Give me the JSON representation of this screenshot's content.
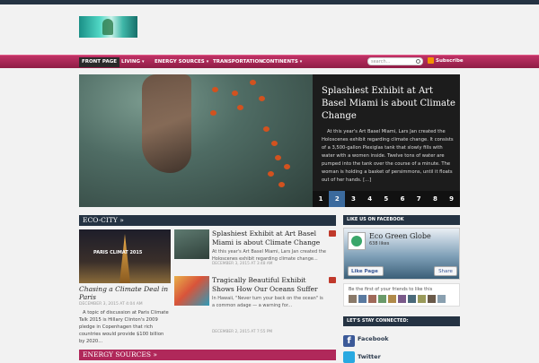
{
  "nav": {
    "items": [
      {
        "label": "FRONT PAGE",
        "active": true,
        "has_dropdown": false
      },
      {
        "label": "LIVING",
        "active": false,
        "has_dropdown": true
      },
      {
        "label": "ENERGY SOURCES",
        "active": false,
        "has_dropdown": true
      },
      {
        "label": "TRANSPORTATION",
        "active": false,
        "has_dropdown": false
      },
      {
        "label": "CONTINENTS",
        "active": false,
        "has_dropdown": true
      }
    ],
    "search_placeholder": "search...",
    "subscribe_label": "Subscribe"
  },
  "slider": {
    "title": "Splashiest Exhibit at Art Basel Miami is about Climate Change",
    "text": "At this year's Art Basel Miami, Lars Jan created the Holoscenes exhibit regarding climate change. It consists of a 3,500-gallon Plexiglas tank that slowly fills with water with a women inside. Twelve tons of water are pumped into the tank over the course of a minute. The woman is holding a basket of persimmons, until it floats out of her hands. [...]",
    "pages": [
      "1",
      "2",
      "3",
      "4",
      "5",
      "6",
      "7",
      "8",
      "9",
      "10"
    ],
    "active_page": "2"
  },
  "eco_city": {
    "heading": "ECO-CITY »",
    "feature": {
      "image_label": "PARIS CLIMAT 2015",
      "title": "Chasing a Climate Deal in Paris",
      "date": "DECEMBER 3, 2015 AT 4:04 AM",
      "excerpt": "A topic of discussion at Paris Climate Talk 2015 is Hillary Clinton's 2009 pledge in Copenhagen that rich countries would provide $100 billion by 2020..."
    },
    "posts": [
      {
        "title": "Splashiest Exhibit at Art Basel Miami is about Climate Change",
        "excerpt": "At this year's Art Basel Miami, Lars Jan created the Holoscenes exhibit regarding climate change...",
        "date": "DECEMBER 3, 2015 AT 3:48 AM",
        "comments": "0"
      },
      {
        "title": "Tragically Beautiful Exhibit Shows How Our Oceans Suffer",
        "excerpt": "In Hawaii, \"Never turn your back on the ocean\" is a common adage — a warning for...",
        "date": "DECEMBER 2, 2015 AT 7:55 PM",
        "comments": "0"
      }
    ]
  },
  "energy_sources": {
    "heading": "ENERGY SOURCES »"
  },
  "sidebar": {
    "facebook_heading": "LIKE US ON FACEBOOK",
    "page_name": "Eco Green Globe",
    "likes": "638 likes",
    "like_button": "Like Page",
    "share_button": "Share",
    "friends_text": "Be the first of your friends to like this",
    "connect_heading": "LET'S STAY CONNECTED:",
    "connect_items": [
      "Facebook",
      "Twitter"
    ]
  },
  "colors": {
    "nav_pink": "#b0285a",
    "dark_navy": "#253343",
    "pager_active": "#3b6a9d"
  }
}
